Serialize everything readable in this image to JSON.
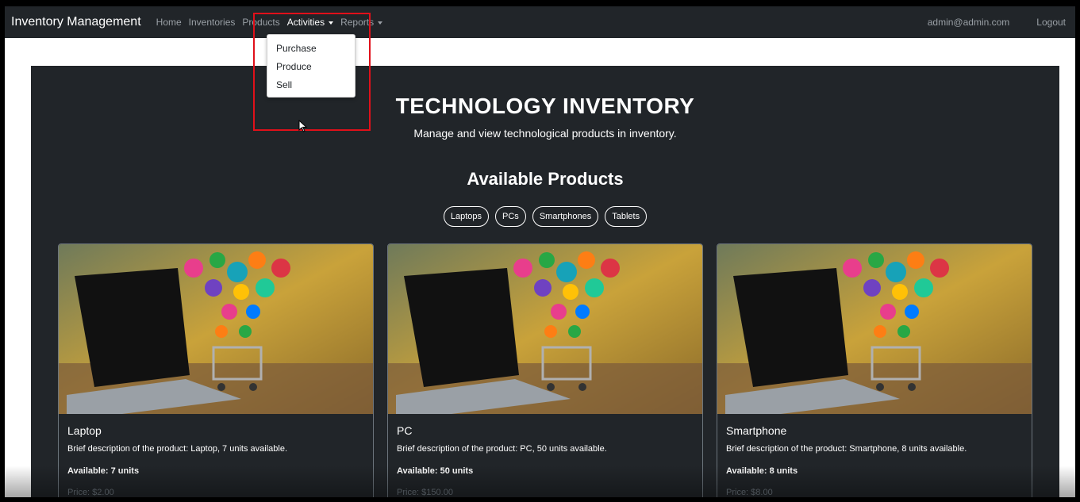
{
  "navbar": {
    "brand": "Inventory Management",
    "links": [
      "Home",
      "Inventories",
      "Products"
    ],
    "activities": "Activities",
    "reports": "Reports",
    "user": "admin@admin.com",
    "logout": "Logout"
  },
  "dropdown": {
    "items": [
      "Purchase",
      "Produce",
      "Sell"
    ]
  },
  "hero": {
    "title": "TECHNOLOGY INVENTORY",
    "subtitle": "Manage and view technological products in inventory."
  },
  "products_section": {
    "title": "Available Products",
    "filters": [
      "Laptops",
      "PCs",
      "Smartphones",
      "Tablets"
    ]
  },
  "cards": [
    {
      "title": "Laptop",
      "description": "Brief description of the product: Laptop, 7 units available.",
      "available": "Available: 7 units",
      "price": "Price: $2.00"
    },
    {
      "title": "PC",
      "description": "Brief description of the product: PC, 50 units available.",
      "available": "Available: 50 units",
      "price": "Price: $150.00"
    },
    {
      "title": "Smartphone",
      "description": "Brief description of the product: Smartphone, 8 units available.",
      "available": "Available: 8 units",
      "price": "Price: $8.00"
    }
  ],
  "colors": {
    "navbar": "#212529",
    "hero": "#212529",
    "highlight": "#e0101a"
  }
}
